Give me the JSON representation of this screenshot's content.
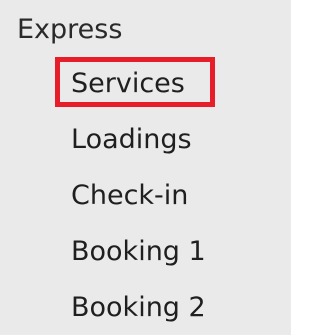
{
  "menu": {
    "header": "Express",
    "items": [
      {
        "label": "Services",
        "highlighted": true
      },
      {
        "label": "Loadings",
        "highlighted": false
      },
      {
        "label": "Check-in",
        "highlighted": false
      },
      {
        "label": "Booking 1",
        "highlighted": false
      },
      {
        "label": "Booking 2",
        "highlighted": false
      }
    ]
  },
  "colors": {
    "panel_background": "#eaeaea",
    "highlight_border": "#e81d2a",
    "text": "#1f1f1f"
  }
}
